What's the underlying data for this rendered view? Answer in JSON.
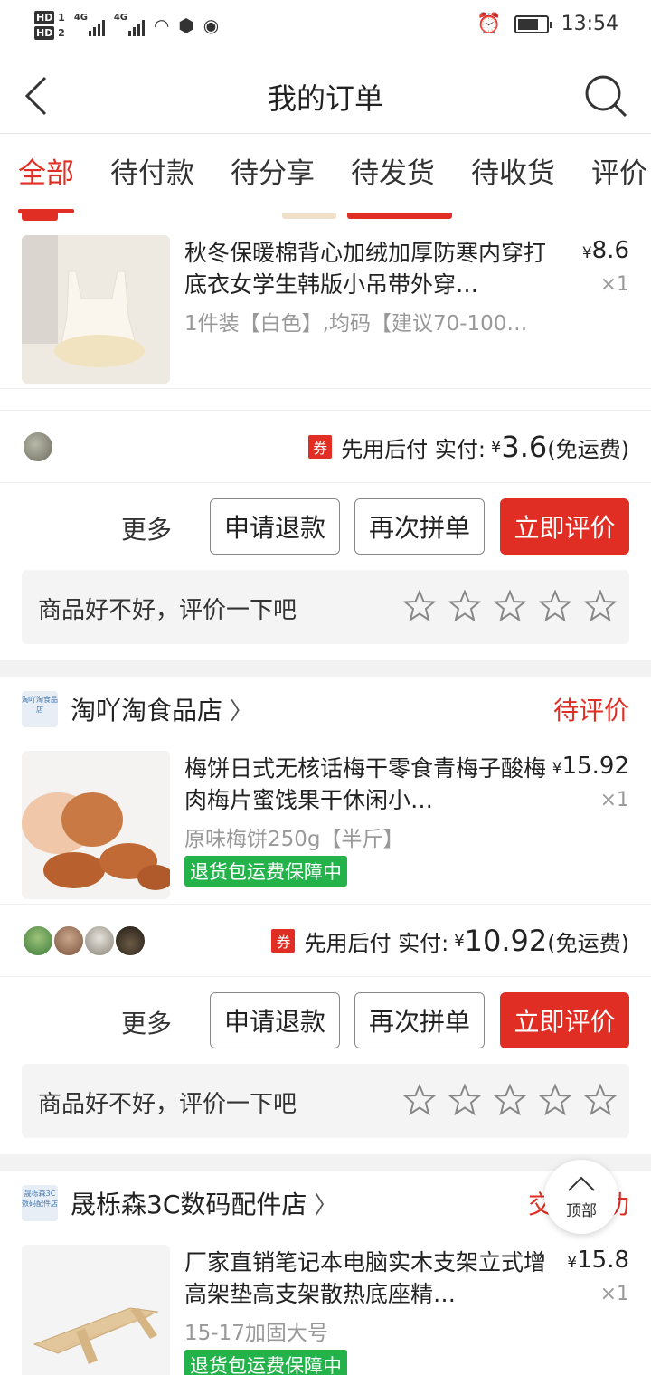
{
  "status_bar": {
    "time": "13:54",
    "hd1": "HD",
    "hd2": "HD",
    "net1": "4G",
    "net2": "4G"
  },
  "header": {
    "title": "我的订单",
    "back_icon": "back-arrow-icon",
    "search_icon": "search-icon"
  },
  "tabs": [
    "全部",
    "待付款",
    "待分享",
    "待发货",
    "待收货",
    "评价"
  ],
  "orders": [
    {
      "goods": {
        "title": "秋冬保暖棉背心加绒加厚防寒内穿打底衣女学生韩版小吊带外穿…",
        "spec": "1件装【白色】,均码【建议70-100…",
        "price_symbol": "¥",
        "price": "8.6",
        "qty": "×1"
      },
      "pay": {
        "coupon": "券",
        "method": "先用后付",
        "paid_label": "实付:",
        "symbol": "¥",
        "amount": "3.6",
        "shipping": "(免运费)"
      },
      "actions": {
        "more": "更多",
        "refund": "申请退款",
        "reorder": "再次拼单",
        "review": "立即评价"
      },
      "rate_prompt": "商品好不好，评价一下吧"
    },
    {
      "shop": {
        "name": "淘吖淘食品店",
        "logo_text": "淘吖淘食品店"
      },
      "status": "待评价",
      "goods": {
        "title": "梅饼日式无核话梅干零食青梅子酸梅肉梅片蜜饯果干休闲小…",
        "spec": "原味梅饼250g【半斤】",
        "badge": "退货包运费保障中",
        "price_symbol": "¥",
        "price": "15.92",
        "qty": "×1"
      },
      "pay": {
        "coupon": "券",
        "method": "先用后付",
        "paid_label": "实付:",
        "symbol": "¥",
        "amount": "10.92",
        "shipping": "(免运费)"
      },
      "actions": {
        "more": "更多",
        "refund": "申请退款",
        "reorder": "再次拼单",
        "review": "立即评价"
      },
      "rate_prompt": "商品好不好，评价一下吧"
    },
    {
      "shop": {
        "name": "晟栎森3C数码配件店",
        "logo_text": "晟栎森3C数码配件店"
      },
      "status": "交易成功",
      "goods": {
        "title": "厂家直销笔记本电脑实木支架立式增高架垫高支架散热底座精…",
        "spec": "15-17加固大号",
        "badge": "退货包运费保障中",
        "price_symbol": "¥",
        "price": "15.8",
        "qty": "×1"
      }
    }
  ],
  "back_to_top": "顶部",
  "colors": {
    "accent": "#e02e24",
    "badge_green": "#24b24b"
  }
}
